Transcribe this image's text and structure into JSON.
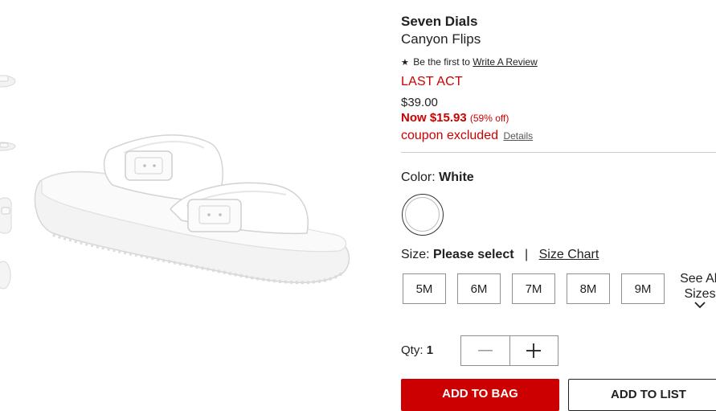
{
  "product": {
    "brand": "Seven Dials",
    "name": "Canyon Flips",
    "review_prefix": "Be the first to",
    "review_link": "Write A Review",
    "badge": "LAST ACT",
    "original_price": "$39.00",
    "sale_price": "Now $15.93",
    "discount": "(59% off)",
    "coupon_text": "coupon excluded",
    "coupon_link": "Details"
  },
  "color": {
    "label": "Color:",
    "value": "White",
    "swatch": "#ffffff"
  },
  "size": {
    "label": "Size:",
    "value": "Please select",
    "separator": "|",
    "chart_link": "Size Chart",
    "options": [
      "5M",
      "6M",
      "7M",
      "8M",
      "9M"
    ],
    "see_all_line1": "See All",
    "see_all_line2": "Sizes"
  },
  "quantity": {
    "label": "Qty:",
    "value": "1"
  },
  "actions": {
    "add_to_bag": "ADD TO BAG",
    "add_to_list": "ADD TO LIST"
  },
  "colors": {
    "accent": "#cc0000",
    "text": "#212121"
  }
}
